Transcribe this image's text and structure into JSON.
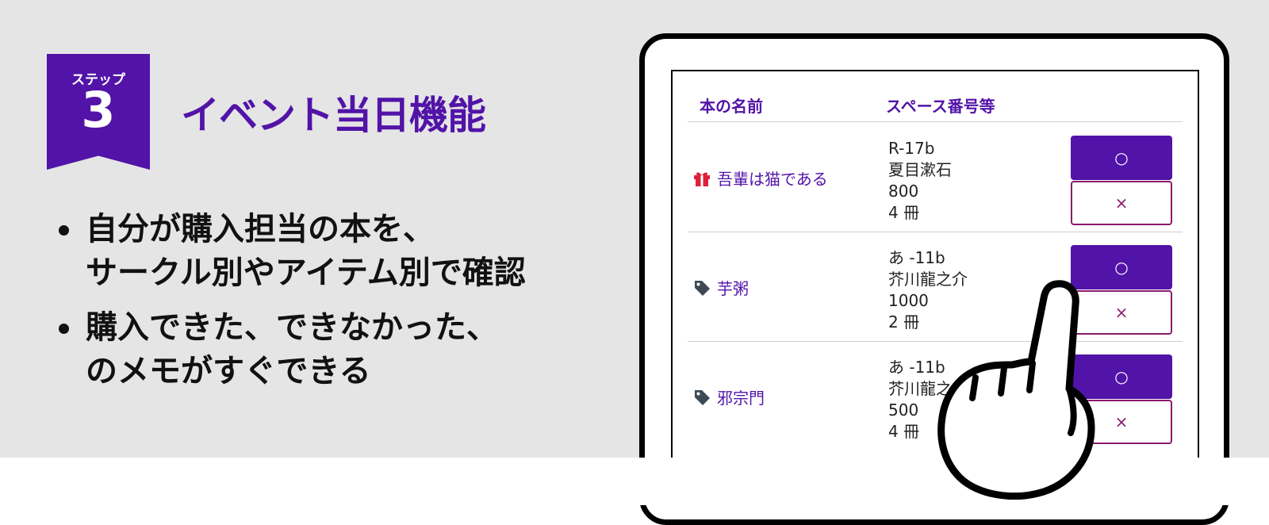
{
  "step": {
    "label": "ステップ",
    "number": "3"
  },
  "title": "イベント当日機能",
  "bullets": [
    {
      "lines": [
        "自分が購入担当の本を、",
        "サークル別やアイテム別で確認"
      ]
    },
    {
      "lines": [
        "購入できた、できなかった、",
        "のメモがすぐできる"
      ]
    }
  ],
  "table": {
    "headers": {
      "book": "本の名前",
      "space": "スペース番号等"
    },
    "rows": [
      {
        "icon": "gift-icon",
        "name": "吾輩は猫である",
        "space": "R-17b",
        "author": "夏目漱石",
        "price": "800",
        "qty": "4 冊",
        "ok": "○",
        "ng": "×"
      },
      {
        "icon": "tag-icon",
        "name": "芋粥",
        "space": "あ -11b",
        "author": "芥川龍之介",
        "price": "1000",
        "qty": "2 冊",
        "ok": "○",
        "ng": "×"
      },
      {
        "icon": "tag-icon",
        "name": "邪宗門",
        "space": "あ -11b",
        "author": "芥川龍之",
        "price": "500",
        "qty": "4 冊",
        "ok": "○",
        "ng": "×"
      }
    ]
  },
  "colors": {
    "accent": "#5213a8",
    "ng": "#8b1a6b",
    "gift": "#e0203a",
    "tag": "#3d4a55",
    "background": "#e5e5e5"
  }
}
